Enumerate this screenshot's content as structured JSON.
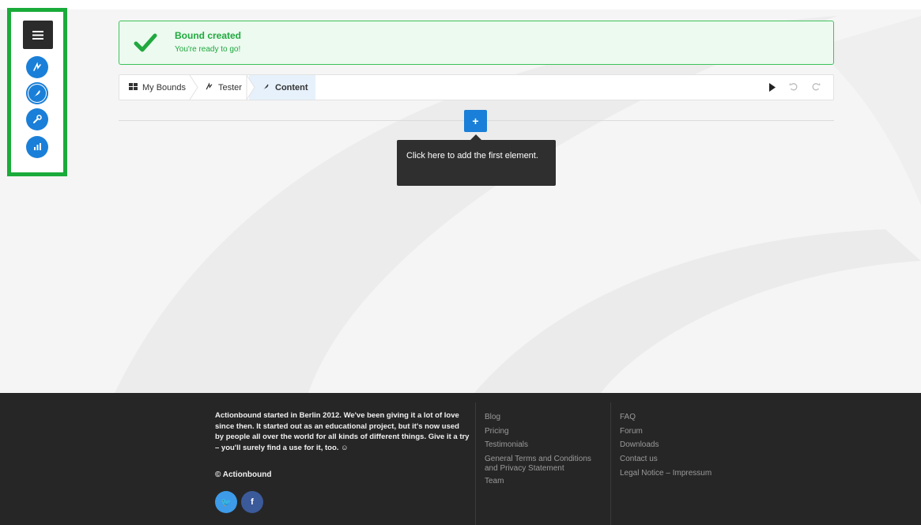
{
  "toolbar": {
    "menu_icon": "hamburger-icon",
    "tools": [
      {
        "name": "bound-settings",
        "icon": "signature-icon"
      },
      {
        "name": "content-editor",
        "icon": "quill-icon"
      },
      {
        "name": "tools",
        "icon": "wrench-icon"
      },
      {
        "name": "statistics",
        "icon": "bar-chart-icon"
      }
    ]
  },
  "banner": {
    "title": "Bound created",
    "subtitle": "You're ready to go!",
    "icon": "checkmark-icon"
  },
  "breadcrumb": {
    "items": [
      {
        "label": "My Bounds",
        "icon": "grid-icon"
      },
      {
        "label": "Tester",
        "icon": "signature-icon"
      },
      {
        "label": "Content",
        "icon": "quill-icon"
      }
    ],
    "actions": [
      "play-icon",
      "undo-icon",
      "redo-icon"
    ]
  },
  "editor": {
    "add_label": "+",
    "tooltip": "Click here to add the first element."
  },
  "footer": {
    "about": "Actionbound started in Berlin 2012. We've been giving it a lot of love since then. It started out as an educational project, but it's now used by people all over the world for all kinds of different things. Give it a try – you'll surely find a use for it, too. ☺",
    "copyright": "© Actionbound",
    "social": [
      {
        "icon": "twitter-icon",
        "glyph": "🐦",
        "color": "#3d9be9"
      },
      {
        "icon": "facebook-icon",
        "glyph": "f",
        "color": "#3b5a9a"
      }
    ],
    "col1": [
      "Blog",
      "Pricing",
      "Testimonials",
      "General Terms and Conditions and Privacy Statement",
      "Team"
    ],
    "col2": [
      "FAQ",
      "Forum",
      "Downloads",
      "Contact us",
      "Legal Notice – Impressum"
    ]
  },
  "colors": {
    "accent": "#1a7fd8",
    "success": "#21a83f",
    "highlight": "#1aab3a",
    "footer_bg": "#262626"
  }
}
